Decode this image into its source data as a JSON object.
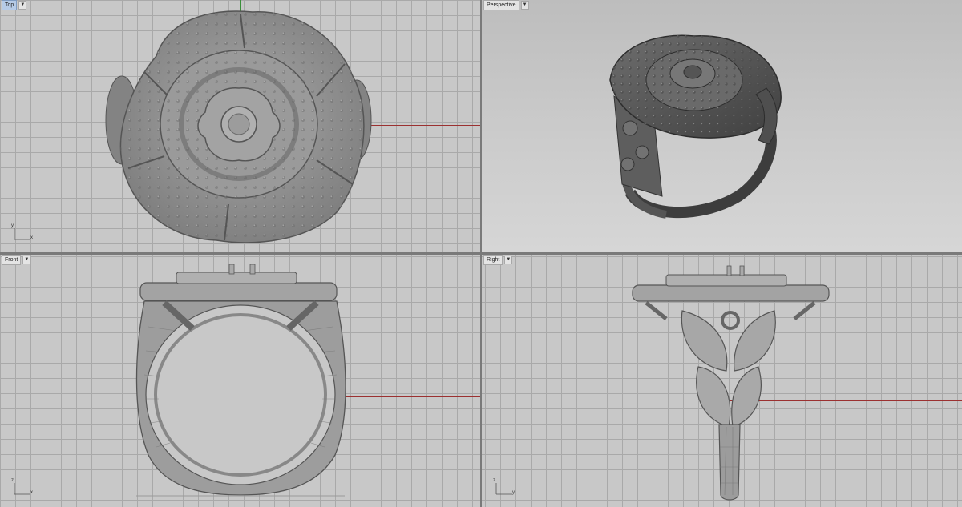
{
  "viewports": {
    "top": {
      "label": "Top",
      "axes": {
        "x": "x",
        "y": "y"
      }
    },
    "perspective": {
      "label": "Perspective"
    },
    "front": {
      "label": "Front",
      "axes": {
        "x": "x",
        "z": "z"
      }
    },
    "right": {
      "label": "Right",
      "axes": {
        "y": "y",
        "z": "z"
      }
    }
  },
  "icons": {
    "viewport_menu": "chevron-down-icon"
  },
  "colors": {
    "grid_background": "#c8c8c8",
    "grid_line": "#a9a9a9",
    "x_axis": "#9b3030",
    "y_axis": "#3a8f3a",
    "model": "#8c8c8c",
    "active_label": "#b6cbe6"
  }
}
